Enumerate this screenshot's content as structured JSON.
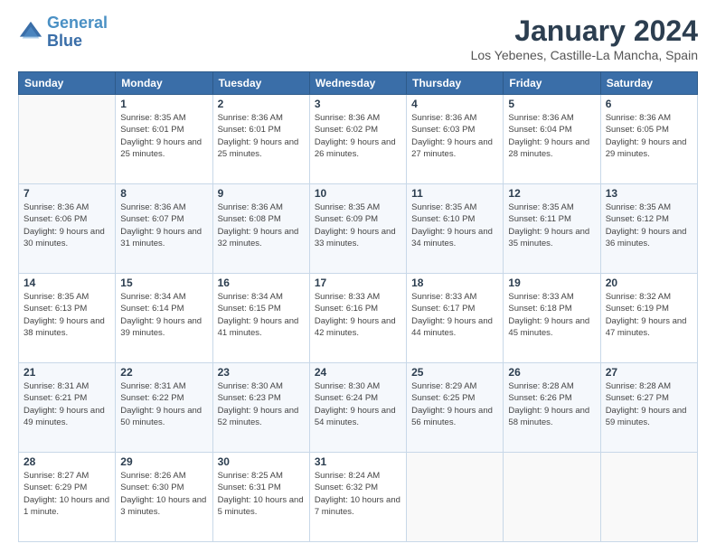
{
  "logo": {
    "line1": "General",
    "line2": "Blue"
  },
  "title": "January 2024",
  "subtitle": "Los Yebenes, Castille-La Mancha, Spain",
  "days_of_week": [
    "Sunday",
    "Monday",
    "Tuesday",
    "Wednesday",
    "Thursday",
    "Friday",
    "Saturday"
  ],
  "weeks": [
    [
      {
        "day": "",
        "sunrise": "",
        "sunset": "",
        "daylight": ""
      },
      {
        "day": "1",
        "sunrise": "Sunrise: 8:35 AM",
        "sunset": "Sunset: 6:01 PM",
        "daylight": "Daylight: 9 hours and 25 minutes."
      },
      {
        "day": "2",
        "sunrise": "Sunrise: 8:36 AM",
        "sunset": "Sunset: 6:01 PM",
        "daylight": "Daylight: 9 hours and 25 minutes."
      },
      {
        "day": "3",
        "sunrise": "Sunrise: 8:36 AM",
        "sunset": "Sunset: 6:02 PM",
        "daylight": "Daylight: 9 hours and 26 minutes."
      },
      {
        "day": "4",
        "sunrise": "Sunrise: 8:36 AM",
        "sunset": "Sunset: 6:03 PM",
        "daylight": "Daylight: 9 hours and 27 minutes."
      },
      {
        "day": "5",
        "sunrise": "Sunrise: 8:36 AM",
        "sunset": "Sunset: 6:04 PM",
        "daylight": "Daylight: 9 hours and 28 minutes."
      },
      {
        "day": "6",
        "sunrise": "Sunrise: 8:36 AM",
        "sunset": "Sunset: 6:05 PM",
        "daylight": "Daylight: 9 hours and 29 minutes."
      }
    ],
    [
      {
        "day": "7",
        "sunrise": "Sunrise: 8:36 AM",
        "sunset": "Sunset: 6:06 PM",
        "daylight": "Daylight: 9 hours and 30 minutes."
      },
      {
        "day": "8",
        "sunrise": "Sunrise: 8:36 AM",
        "sunset": "Sunset: 6:07 PM",
        "daylight": "Daylight: 9 hours and 31 minutes."
      },
      {
        "day": "9",
        "sunrise": "Sunrise: 8:36 AM",
        "sunset": "Sunset: 6:08 PM",
        "daylight": "Daylight: 9 hours and 32 minutes."
      },
      {
        "day": "10",
        "sunrise": "Sunrise: 8:35 AM",
        "sunset": "Sunset: 6:09 PM",
        "daylight": "Daylight: 9 hours and 33 minutes."
      },
      {
        "day": "11",
        "sunrise": "Sunrise: 8:35 AM",
        "sunset": "Sunset: 6:10 PM",
        "daylight": "Daylight: 9 hours and 34 minutes."
      },
      {
        "day": "12",
        "sunrise": "Sunrise: 8:35 AM",
        "sunset": "Sunset: 6:11 PM",
        "daylight": "Daylight: 9 hours and 35 minutes."
      },
      {
        "day": "13",
        "sunrise": "Sunrise: 8:35 AM",
        "sunset": "Sunset: 6:12 PM",
        "daylight": "Daylight: 9 hours and 36 minutes."
      }
    ],
    [
      {
        "day": "14",
        "sunrise": "Sunrise: 8:35 AM",
        "sunset": "Sunset: 6:13 PM",
        "daylight": "Daylight: 9 hours and 38 minutes."
      },
      {
        "day": "15",
        "sunrise": "Sunrise: 8:34 AM",
        "sunset": "Sunset: 6:14 PM",
        "daylight": "Daylight: 9 hours and 39 minutes."
      },
      {
        "day": "16",
        "sunrise": "Sunrise: 8:34 AM",
        "sunset": "Sunset: 6:15 PM",
        "daylight": "Daylight: 9 hours and 41 minutes."
      },
      {
        "day": "17",
        "sunrise": "Sunrise: 8:33 AM",
        "sunset": "Sunset: 6:16 PM",
        "daylight": "Daylight: 9 hours and 42 minutes."
      },
      {
        "day": "18",
        "sunrise": "Sunrise: 8:33 AM",
        "sunset": "Sunset: 6:17 PM",
        "daylight": "Daylight: 9 hours and 44 minutes."
      },
      {
        "day": "19",
        "sunrise": "Sunrise: 8:33 AM",
        "sunset": "Sunset: 6:18 PM",
        "daylight": "Daylight: 9 hours and 45 minutes."
      },
      {
        "day": "20",
        "sunrise": "Sunrise: 8:32 AM",
        "sunset": "Sunset: 6:19 PM",
        "daylight": "Daylight: 9 hours and 47 minutes."
      }
    ],
    [
      {
        "day": "21",
        "sunrise": "Sunrise: 8:31 AM",
        "sunset": "Sunset: 6:21 PM",
        "daylight": "Daylight: 9 hours and 49 minutes."
      },
      {
        "day": "22",
        "sunrise": "Sunrise: 8:31 AM",
        "sunset": "Sunset: 6:22 PM",
        "daylight": "Daylight: 9 hours and 50 minutes."
      },
      {
        "day": "23",
        "sunrise": "Sunrise: 8:30 AM",
        "sunset": "Sunset: 6:23 PM",
        "daylight": "Daylight: 9 hours and 52 minutes."
      },
      {
        "day": "24",
        "sunrise": "Sunrise: 8:30 AM",
        "sunset": "Sunset: 6:24 PM",
        "daylight": "Daylight: 9 hours and 54 minutes."
      },
      {
        "day": "25",
        "sunrise": "Sunrise: 8:29 AM",
        "sunset": "Sunset: 6:25 PM",
        "daylight": "Daylight: 9 hours and 56 minutes."
      },
      {
        "day": "26",
        "sunrise": "Sunrise: 8:28 AM",
        "sunset": "Sunset: 6:26 PM",
        "daylight": "Daylight: 9 hours and 58 minutes."
      },
      {
        "day": "27",
        "sunrise": "Sunrise: 8:28 AM",
        "sunset": "Sunset: 6:27 PM",
        "daylight": "Daylight: 9 hours and 59 minutes."
      }
    ],
    [
      {
        "day": "28",
        "sunrise": "Sunrise: 8:27 AM",
        "sunset": "Sunset: 6:29 PM",
        "daylight": "Daylight: 10 hours and 1 minute."
      },
      {
        "day": "29",
        "sunrise": "Sunrise: 8:26 AM",
        "sunset": "Sunset: 6:30 PM",
        "daylight": "Daylight: 10 hours and 3 minutes."
      },
      {
        "day": "30",
        "sunrise": "Sunrise: 8:25 AM",
        "sunset": "Sunset: 6:31 PM",
        "daylight": "Daylight: 10 hours and 5 minutes."
      },
      {
        "day": "31",
        "sunrise": "Sunrise: 8:24 AM",
        "sunset": "Sunset: 6:32 PM",
        "daylight": "Daylight: 10 hours and 7 minutes."
      },
      {
        "day": "",
        "sunrise": "",
        "sunset": "",
        "daylight": ""
      },
      {
        "day": "",
        "sunrise": "",
        "sunset": "",
        "daylight": ""
      },
      {
        "day": "",
        "sunrise": "",
        "sunset": "",
        "daylight": ""
      }
    ]
  ]
}
